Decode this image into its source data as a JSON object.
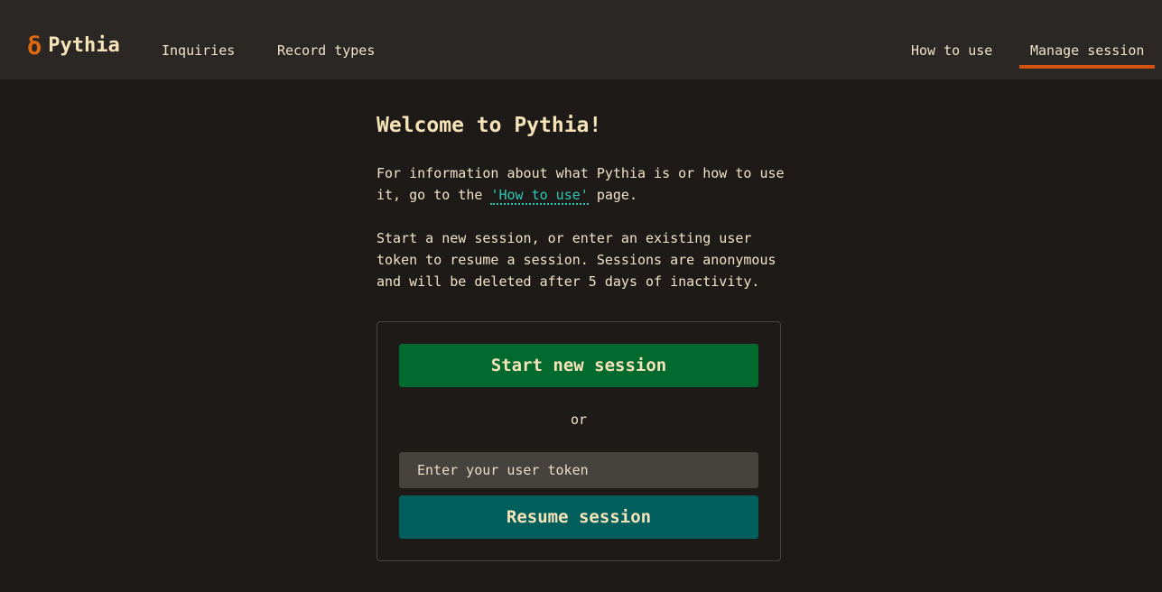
{
  "header": {
    "brand_icon": "δ",
    "brand_name": "Pythia",
    "nav_left": [
      "Inquiries",
      "Record types"
    ],
    "nav_right": [
      "How to use",
      "Manage session"
    ],
    "active_nav": "Manage session"
  },
  "main": {
    "title": "Welcome to Pythia!",
    "intro_prefix": "For information about what Pythia is or how to use it, go to the ",
    "intro_link": "'How to use'",
    "intro_suffix": " page.",
    "session_info": "Start a new session, or enter an existing user token to resume a session. Sessions are anonymous and will be deleted after 5 days of inactivity."
  },
  "session_panel": {
    "start_button": "Start new session",
    "or_text": "or",
    "token_placeholder": "Enter your user token",
    "token_value": "",
    "resume_button": "Resume session"
  },
  "colors": {
    "background": "#1e1a17",
    "header_background": "#2a2725",
    "accent": "#e0690f",
    "active_underline": "#d4530f",
    "link": "#2ec6b6",
    "start_button": "#036a2f",
    "resume_button": "#005e5d"
  }
}
